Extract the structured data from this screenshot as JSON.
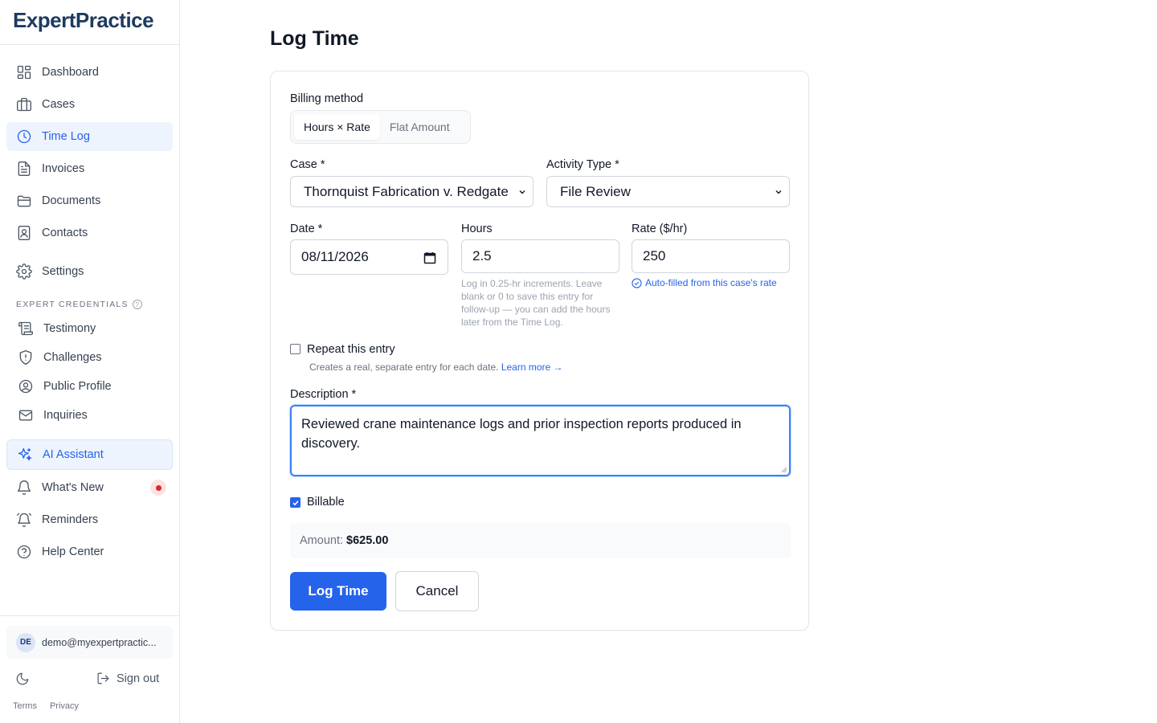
{
  "app": {
    "logo": "ExpertPractice"
  },
  "sidebar": {
    "items": [
      {
        "label": "Dashboard",
        "icon": "dashboard-icon"
      },
      {
        "label": "Cases",
        "icon": "briefcase-icon"
      },
      {
        "label": "Time Log",
        "icon": "clock-icon",
        "active": true
      },
      {
        "label": "Invoices",
        "icon": "invoice-icon"
      },
      {
        "label": "Documents",
        "icon": "folder-icon"
      },
      {
        "label": "Contacts",
        "icon": "contact-book-icon"
      },
      {
        "label": "Settings",
        "icon": "gear-icon"
      }
    ],
    "section_label": "EXPERT CREDENTIALS",
    "credential_items": [
      {
        "label": "Testimony",
        "icon": "scroll-icon"
      },
      {
        "label": "Challenges",
        "icon": "shield-alert-icon"
      },
      {
        "label": "Public Profile",
        "icon": "user-circle-icon"
      },
      {
        "label": "Inquiries",
        "icon": "mail-icon"
      }
    ],
    "ai_assistant": "AI Assistant",
    "bottom_items": [
      {
        "label": "What's New",
        "icon": "bell-icon"
      },
      {
        "label": "Reminders",
        "icon": "alarm-icon"
      },
      {
        "label": "Help Center",
        "icon": "help-circle-icon"
      }
    ],
    "user": {
      "initials": "DE",
      "email": "demo@myexpertpractic..."
    },
    "sign_out": "Sign out",
    "terms": "Terms",
    "privacy": "Privacy"
  },
  "main": {
    "title": "Log Time",
    "billing_method": {
      "label": "Billing method",
      "options": [
        "Hours × Rate",
        "Flat Amount"
      ],
      "selected": "Hours × Rate"
    },
    "case": {
      "label": "Case *",
      "value": "Thornquist Fabrication v. Redgate"
    },
    "activity_type": {
      "label": "Activity Type *",
      "value": "File Review"
    },
    "date": {
      "label": "Date *",
      "value": "08/11/2026"
    },
    "hours": {
      "label": "Hours",
      "value": "2.5",
      "help": "Log in 0.25-hr increments. Leave blank or 0 to save this entry for follow-up — you can add the hours later from the Time Log."
    },
    "rate": {
      "label": "Rate ($/hr)",
      "value": "250",
      "note": "Auto-filled from this case's rate"
    },
    "repeat": {
      "label": "Repeat this entry",
      "checked": false,
      "help": "Creates a real, separate entry for each date.",
      "learn_more": "Learn more →"
    },
    "description": {
      "label": "Description *",
      "value": "Reviewed crane maintenance logs and prior inspection reports produced in discovery."
    },
    "billable": {
      "label": "Billable",
      "checked": true
    },
    "amount": {
      "label": "Amount:",
      "value": "$625.00"
    },
    "submit_label": "Log Time",
    "cancel_label": "Cancel"
  },
  "colors": {
    "accent": "#2563eb",
    "alert": "#dc2626"
  }
}
